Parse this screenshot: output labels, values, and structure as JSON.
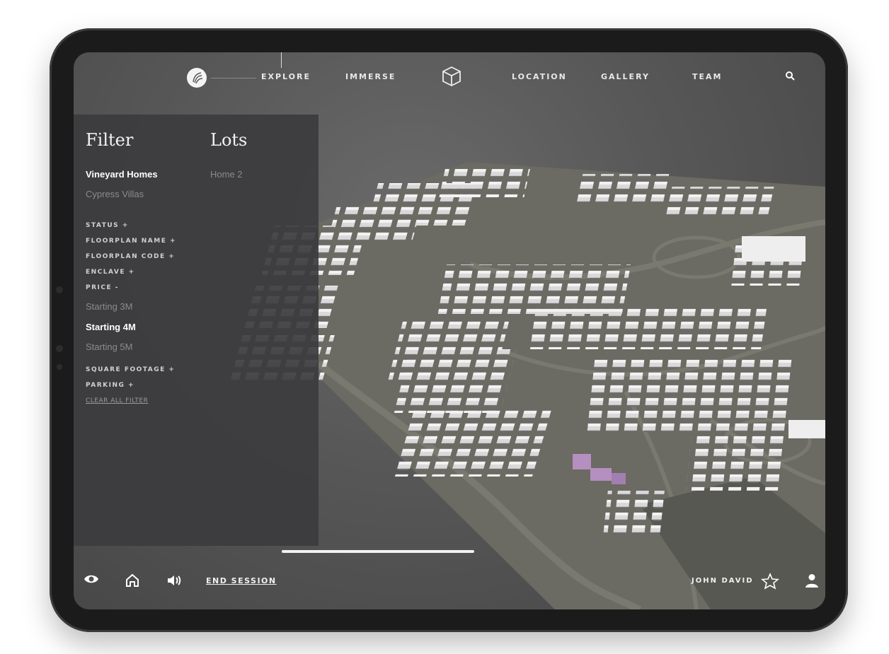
{
  "nav": {
    "items": [
      "EXPLORE",
      "IMMERSE",
      "LOCATION",
      "GALLERY",
      "TEAM"
    ],
    "active": "EXPLORE",
    "icons": {
      "logo": "leaf-logo-icon",
      "cube": "cube-icon",
      "search": "search-icon"
    }
  },
  "filter_panel": {
    "filter_title": "Filter",
    "lots_title": "Lots",
    "collections": [
      {
        "label": "Vineyard Homes",
        "selected": true
      },
      {
        "label": "Cypress Villas",
        "selected": false
      }
    ],
    "lots": [
      "Home 2"
    ],
    "facets": {
      "status": "STATUS  +",
      "floorplan_name": "FLOORPLAN NAME  +",
      "floorplan_code": "FLOORPLAN CODE  +",
      "enclave": "ENCLAVE  +",
      "price": "PRICE  -",
      "square_footage": "SQUARE FOOTAGE  +",
      "parking": "PARKING  +"
    },
    "price_options": [
      {
        "label": "Starting 3M",
        "selected": false
      },
      {
        "label": "Starting 4M",
        "selected": true
      },
      {
        "label": "Starting 5M",
        "selected": false
      }
    ],
    "clear_all": "CLEAR ALL FILTER"
  },
  "bottom_bar": {
    "end_session": "END SESSION",
    "user_name": "JOHN DAVID",
    "icons": [
      "eye-icon",
      "home-icon",
      "volume-icon",
      "star-icon",
      "user-icon"
    ]
  },
  "colors": {
    "panel": "#3c3c3e",
    "highlight_lot": "#b58fc0",
    "text": "#ffffff"
  }
}
